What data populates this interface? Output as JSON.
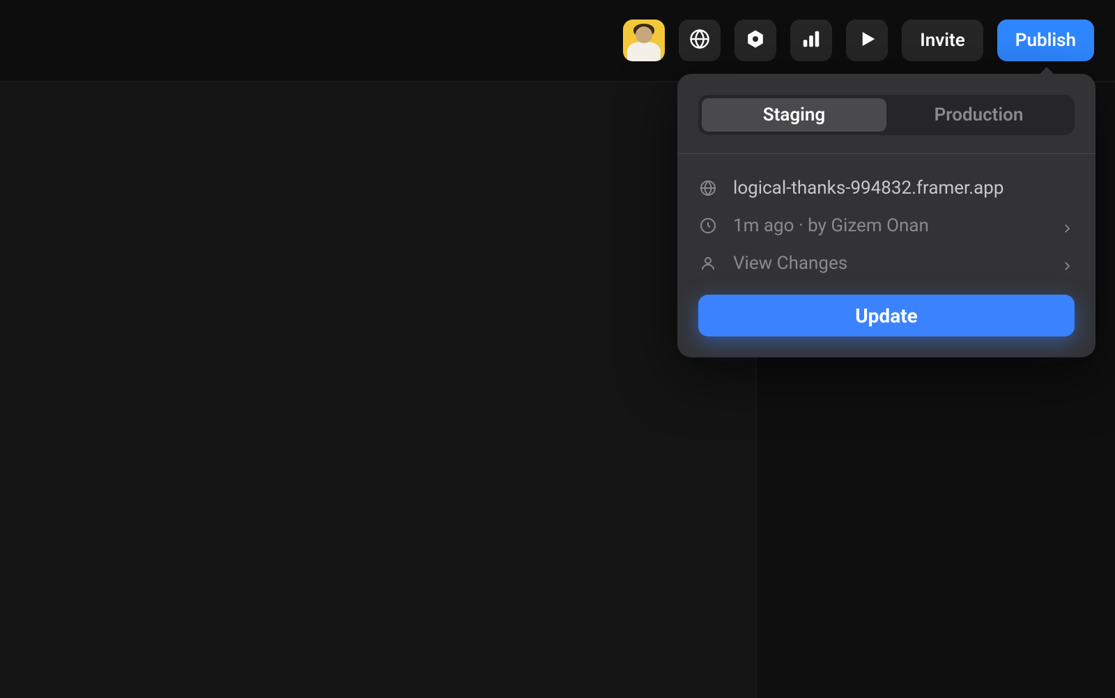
{
  "toolbar": {
    "invite_label": "Invite",
    "publish_label": "Publish",
    "icons": {
      "avatar": "user-avatar",
      "globe": "globe-icon",
      "component": "hexagon-dot-icon",
      "analytics": "bar-chart-icon",
      "play": "play-icon"
    }
  },
  "popover": {
    "tabs": {
      "staging": "Staging",
      "production": "Production",
      "active": "staging"
    },
    "site_url": "logical-thanks-994832.framer.app",
    "last_publish": "1m ago · by Gizem Onan",
    "view_changes": "View Changes",
    "update_label": "Update"
  }
}
